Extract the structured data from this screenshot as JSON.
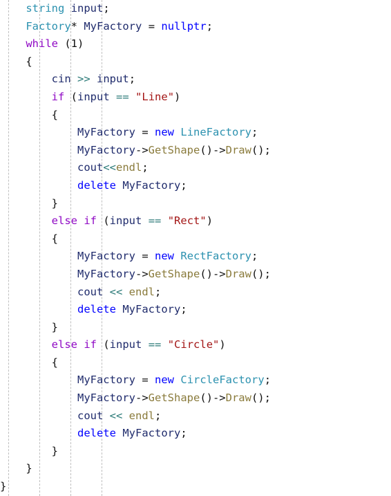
{
  "editor": {
    "language": "C++",
    "font_size_px": 15.5,
    "line_height_px": 25.6,
    "background": "#FFFFFF",
    "indent_guide_color": "#BFBFBF",
    "indent_guide_x": [
      12,
      57,
      102,
      147
    ]
  },
  "colors": {
    "keyword": "#0000FF",
    "control_keyword": "#8F08C4",
    "type": "#2B91AF",
    "identifier": "#1F2B6C",
    "function": "#8A7B3C",
    "string": "#A31515",
    "operator": "#2B7A78",
    "punctuation": "#101010"
  },
  "code": {
    "full_text": "    string input;\n    Factory* MyFactory = nullptr;\n    while (1)\n    {\n        cin >> input;\n        if (input == \"Line\")\n        {\n            MyFactory = new LineFactory;\n            MyFactory->GetShape()->Draw();\n            cout<<endl;\n            delete MyFactory;\n        }\n        else if (input == \"Rect\")\n        {\n            MyFactory = new RectFactory;\n            MyFactory->GetShape()->Draw();\n            cout << endl;\n            delete MyFactory;\n        }\n        else if (input == \"Circle\")\n        {\n            MyFactory = new CircleFactory;\n            MyFactory->GetShape()->Draw();\n            cout << endl;\n            delete MyFactory;\n        }\n    }\n}",
    "lines": [
      {
        "id": "line-1",
        "text": "    string input;",
        "tokens": [
          {
            "t": "    ",
            "c": "punct"
          },
          {
            "t": "string",
            "c": "type"
          },
          {
            "t": " ",
            "c": "punct"
          },
          {
            "t": "input",
            "c": "id"
          },
          {
            "t": ";",
            "c": "punct"
          }
        ]
      },
      {
        "id": "line-2",
        "text": "    Factory* MyFactory = nullptr;",
        "tokens": [
          {
            "t": "    ",
            "c": "punct"
          },
          {
            "t": "Factory",
            "c": "type"
          },
          {
            "t": "*",
            "c": "punct"
          },
          {
            "t": " ",
            "c": "punct"
          },
          {
            "t": "MyFactory",
            "c": "id"
          },
          {
            "t": " ",
            "c": "punct"
          },
          {
            "t": "=",
            "c": "punct"
          },
          {
            "t": " ",
            "c": "punct"
          },
          {
            "t": "nullptr",
            "c": "kw"
          },
          {
            "t": ";",
            "c": "punct"
          }
        ]
      },
      {
        "id": "line-3",
        "text": "    while (1)",
        "tokens": [
          {
            "t": "    ",
            "c": "punct"
          },
          {
            "t": "while",
            "c": "ctrl"
          },
          {
            "t": " (",
            "c": "punct"
          },
          {
            "t": "1",
            "c": "punct"
          },
          {
            "t": ")",
            "c": "punct"
          }
        ]
      },
      {
        "id": "line-4",
        "text": "    {",
        "tokens": [
          {
            "t": "    {",
            "c": "punct"
          }
        ]
      },
      {
        "id": "line-5",
        "text": "        cin >> input;",
        "tokens": [
          {
            "t": "        ",
            "c": "punct"
          },
          {
            "t": "cin",
            "c": "id"
          },
          {
            "t": " ",
            "c": "punct"
          },
          {
            "t": ">>",
            "c": "op"
          },
          {
            "t": " ",
            "c": "punct"
          },
          {
            "t": "input",
            "c": "id"
          },
          {
            "t": ";",
            "c": "punct"
          }
        ]
      },
      {
        "id": "line-6",
        "text": "        if (input == \"Line\")",
        "tokens": [
          {
            "t": "        ",
            "c": "punct"
          },
          {
            "t": "if",
            "c": "ctrl"
          },
          {
            "t": " (",
            "c": "punct"
          },
          {
            "t": "input",
            "c": "id"
          },
          {
            "t": " ",
            "c": "punct"
          },
          {
            "t": "==",
            "c": "op"
          },
          {
            "t": " ",
            "c": "punct"
          },
          {
            "t": "\"Line\"",
            "c": "str"
          },
          {
            "t": ")",
            "c": "punct"
          }
        ]
      },
      {
        "id": "line-7",
        "text": "        {",
        "tokens": [
          {
            "t": "        {",
            "c": "punct"
          }
        ]
      },
      {
        "id": "line-8",
        "text": "            MyFactory = new LineFactory;",
        "tokens": [
          {
            "t": "            ",
            "c": "punct"
          },
          {
            "t": "MyFactory",
            "c": "id"
          },
          {
            "t": " ",
            "c": "punct"
          },
          {
            "t": "=",
            "c": "punct"
          },
          {
            "t": " ",
            "c": "punct"
          },
          {
            "t": "new",
            "c": "kw"
          },
          {
            "t": " ",
            "c": "punct"
          },
          {
            "t": "LineFactory",
            "c": "type"
          },
          {
            "t": ";",
            "c": "punct"
          }
        ]
      },
      {
        "id": "line-9",
        "text": "            MyFactory->GetShape()->Draw();",
        "tokens": [
          {
            "t": "            ",
            "c": "punct"
          },
          {
            "t": "MyFactory",
            "c": "id"
          },
          {
            "t": "->",
            "c": "punct"
          },
          {
            "t": "GetShape",
            "c": "fn"
          },
          {
            "t": "()->",
            "c": "punct"
          },
          {
            "t": "Draw",
            "c": "fn"
          },
          {
            "t": "();",
            "c": "punct"
          }
        ]
      },
      {
        "id": "line-10",
        "text": "            cout<<endl;",
        "tokens": [
          {
            "t": "            ",
            "c": "punct"
          },
          {
            "t": "cout",
            "c": "id"
          },
          {
            "t": "<<",
            "c": "op"
          },
          {
            "t": "endl",
            "c": "fn"
          },
          {
            "t": ";",
            "c": "punct"
          }
        ]
      },
      {
        "id": "line-11",
        "text": "            delete MyFactory;",
        "tokens": [
          {
            "t": "            ",
            "c": "punct"
          },
          {
            "t": "delete",
            "c": "kw"
          },
          {
            "t": " ",
            "c": "punct"
          },
          {
            "t": "MyFactory",
            "c": "id"
          },
          {
            "t": ";",
            "c": "punct"
          }
        ]
      },
      {
        "id": "line-12",
        "text": "        }",
        "tokens": [
          {
            "t": "        }",
            "c": "punct"
          }
        ]
      },
      {
        "id": "line-13",
        "text": "        else if (input == \"Rect\")",
        "tokens": [
          {
            "t": "        ",
            "c": "punct"
          },
          {
            "t": "else",
            "c": "ctrl"
          },
          {
            "t": " ",
            "c": "punct"
          },
          {
            "t": "if",
            "c": "ctrl"
          },
          {
            "t": " (",
            "c": "punct"
          },
          {
            "t": "input",
            "c": "id"
          },
          {
            "t": " ",
            "c": "punct"
          },
          {
            "t": "==",
            "c": "op"
          },
          {
            "t": " ",
            "c": "punct"
          },
          {
            "t": "\"Rect\"",
            "c": "str"
          },
          {
            "t": ")",
            "c": "punct"
          }
        ]
      },
      {
        "id": "line-14",
        "text": "        {",
        "tokens": [
          {
            "t": "        {",
            "c": "punct"
          }
        ]
      },
      {
        "id": "line-15",
        "text": "            MyFactory = new RectFactory;",
        "tokens": [
          {
            "t": "            ",
            "c": "punct"
          },
          {
            "t": "MyFactory",
            "c": "id"
          },
          {
            "t": " ",
            "c": "punct"
          },
          {
            "t": "=",
            "c": "punct"
          },
          {
            "t": " ",
            "c": "punct"
          },
          {
            "t": "new",
            "c": "kw"
          },
          {
            "t": " ",
            "c": "punct"
          },
          {
            "t": "RectFactory",
            "c": "type"
          },
          {
            "t": ";",
            "c": "punct"
          }
        ]
      },
      {
        "id": "line-16",
        "text": "            MyFactory->GetShape()->Draw();",
        "tokens": [
          {
            "t": "            ",
            "c": "punct"
          },
          {
            "t": "MyFactory",
            "c": "id"
          },
          {
            "t": "->",
            "c": "punct"
          },
          {
            "t": "GetShape",
            "c": "fn"
          },
          {
            "t": "()->",
            "c": "punct"
          },
          {
            "t": "Draw",
            "c": "fn"
          },
          {
            "t": "();",
            "c": "punct"
          }
        ]
      },
      {
        "id": "line-17",
        "text": "            cout << endl;",
        "tokens": [
          {
            "t": "            ",
            "c": "punct"
          },
          {
            "t": "cout",
            "c": "id"
          },
          {
            "t": " ",
            "c": "punct"
          },
          {
            "t": "<<",
            "c": "op"
          },
          {
            "t": " ",
            "c": "punct"
          },
          {
            "t": "endl",
            "c": "fn"
          },
          {
            "t": ";",
            "c": "punct"
          }
        ]
      },
      {
        "id": "line-18",
        "text": "            delete MyFactory;",
        "tokens": [
          {
            "t": "            ",
            "c": "punct"
          },
          {
            "t": "delete",
            "c": "kw"
          },
          {
            "t": " ",
            "c": "punct"
          },
          {
            "t": "MyFactory",
            "c": "id"
          },
          {
            "t": ";",
            "c": "punct"
          }
        ]
      },
      {
        "id": "line-19",
        "text": "        }",
        "tokens": [
          {
            "t": "        }",
            "c": "punct"
          }
        ]
      },
      {
        "id": "line-20",
        "text": "        else if (input == \"Circle\")",
        "tokens": [
          {
            "t": "        ",
            "c": "punct"
          },
          {
            "t": "else",
            "c": "ctrl"
          },
          {
            "t": " ",
            "c": "punct"
          },
          {
            "t": "if",
            "c": "ctrl"
          },
          {
            "t": " (",
            "c": "punct"
          },
          {
            "t": "input",
            "c": "id"
          },
          {
            "t": " ",
            "c": "punct"
          },
          {
            "t": "==",
            "c": "op"
          },
          {
            "t": " ",
            "c": "punct"
          },
          {
            "t": "\"Circle\"",
            "c": "str"
          },
          {
            "t": ")",
            "c": "punct"
          }
        ]
      },
      {
        "id": "line-21",
        "text": "        {",
        "tokens": [
          {
            "t": "        {",
            "c": "punct"
          }
        ]
      },
      {
        "id": "line-22",
        "text": "            MyFactory = new CircleFactory;",
        "tokens": [
          {
            "t": "            ",
            "c": "punct"
          },
          {
            "t": "MyFactory",
            "c": "id"
          },
          {
            "t": " ",
            "c": "punct"
          },
          {
            "t": "=",
            "c": "punct"
          },
          {
            "t": " ",
            "c": "punct"
          },
          {
            "t": "new",
            "c": "kw"
          },
          {
            "t": " ",
            "c": "punct"
          },
          {
            "t": "CircleFactory",
            "c": "type"
          },
          {
            "t": ";",
            "c": "punct"
          }
        ]
      },
      {
        "id": "line-23",
        "text": "            MyFactory->GetShape()->Draw();",
        "tokens": [
          {
            "t": "            ",
            "c": "punct"
          },
          {
            "t": "MyFactory",
            "c": "id"
          },
          {
            "t": "->",
            "c": "punct"
          },
          {
            "t": "GetShape",
            "c": "fn"
          },
          {
            "t": "()->",
            "c": "punct"
          },
          {
            "t": "Draw",
            "c": "fn"
          },
          {
            "t": "();",
            "c": "punct"
          }
        ]
      },
      {
        "id": "line-24",
        "text": "            cout << endl;",
        "tokens": [
          {
            "t": "            ",
            "c": "punct"
          },
          {
            "t": "cout",
            "c": "id"
          },
          {
            "t": " ",
            "c": "punct"
          },
          {
            "t": "<<",
            "c": "op"
          },
          {
            "t": " ",
            "c": "punct"
          },
          {
            "t": "endl",
            "c": "fn"
          },
          {
            "t": ";",
            "c": "punct"
          }
        ]
      },
      {
        "id": "line-25",
        "text": "            delete MyFactory;",
        "tokens": [
          {
            "t": "            ",
            "c": "punct"
          },
          {
            "t": "delete",
            "c": "kw"
          },
          {
            "t": " ",
            "c": "punct"
          },
          {
            "t": "MyFactory",
            "c": "id"
          },
          {
            "t": ";",
            "c": "punct"
          }
        ]
      },
      {
        "id": "line-26",
        "text": "        }",
        "tokens": [
          {
            "t": "        }",
            "c": "punct"
          }
        ]
      },
      {
        "id": "line-27",
        "text": "    }",
        "tokens": [
          {
            "t": "    }",
            "c": "punct"
          }
        ]
      },
      {
        "id": "line-28",
        "text": "}",
        "tokens": [
          {
            "t": "}",
            "c": "punct"
          }
        ]
      }
    ]
  }
}
